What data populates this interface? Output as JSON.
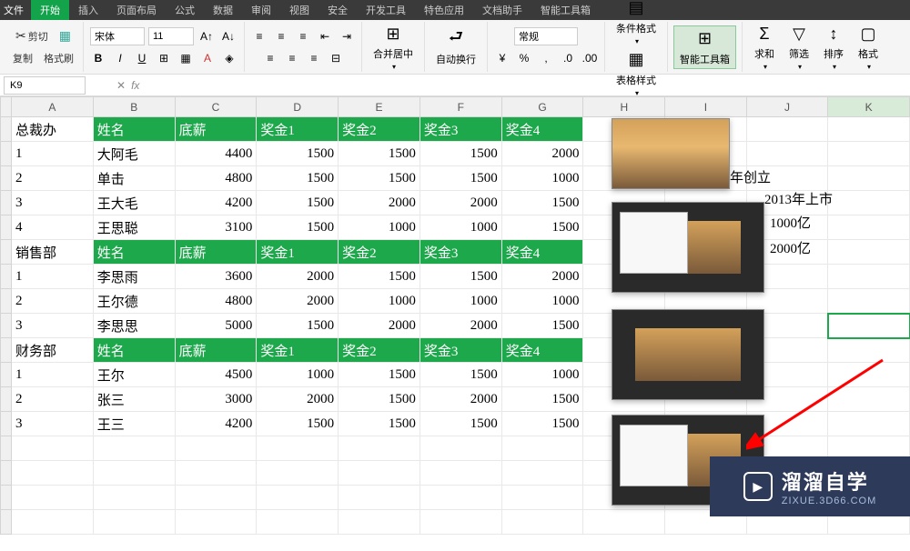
{
  "menu": {
    "file": "文件",
    "tabs": [
      "开始",
      "插入",
      "页面布局",
      "公式",
      "数据",
      "审阅",
      "视图",
      "安全",
      "开发工具",
      "特色应用",
      "文档助手",
      "智能工具箱"
    ],
    "activeTab": 0
  },
  "ribbon": {
    "clipboard": {
      "cut": "剪切",
      "copy": "复制",
      "paint": "格式刷"
    },
    "font": {
      "name": "宋体",
      "size": "11"
    },
    "alignment": {
      "merge": "合并居中",
      "wrap": "自动换行"
    },
    "number": {
      "format": "常规"
    },
    "styles": {
      "cond": "条件格式",
      "table": "表格样式"
    },
    "tools": {
      "smart": "智能工具箱"
    },
    "editing": {
      "sum": "求和",
      "filter": "筛选",
      "sort": "排序",
      "format": "格式"
    }
  },
  "nameBox": "K9",
  "formula": "",
  "columns": [
    "A",
    "B",
    "C",
    "D",
    "E",
    "F",
    "G",
    "H",
    "I",
    "J",
    "K"
  ],
  "rows": [
    {
      "type": "header",
      "cells": [
        "总裁办",
        "姓名",
        "底薪",
        "奖金1",
        "奖金2",
        "奖金3",
        "奖金4"
      ]
    },
    {
      "type": "data",
      "cells": [
        "1",
        "大阿毛",
        "4400",
        "1500",
        "1500",
        "1500",
        "2000"
      ]
    },
    {
      "type": "data",
      "cells": [
        "2",
        "单击",
        "4800",
        "1500",
        "1500",
        "1500",
        "1000"
      ]
    },
    {
      "type": "data",
      "cells": [
        "3",
        "王大毛",
        "4200",
        "1500",
        "2000",
        "2000",
        "1500"
      ]
    },
    {
      "type": "data",
      "cells": [
        "4",
        "王思聪",
        "3100",
        "1500",
        "1000",
        "1000",
        "1500"
      ]
    },
    {
      "type": "header",
      "cells": [
        "销售部",
        "姓名",
        "底薪",
        "奖金1",
        "奖金2",
        "奖金3",
        "奖金4"
      ]
    },
    {
      "type": "data",
      "cells": [
        "1",
        "李思雨",
        "3600",
        "2000",
        "1500",
        "1500",
        "2000"
      ]
    },
    {
      "type": "data",
      "cells": [
        "2",
        "王尔德",
        "4800",
        "2000",
        "1000",
        "1000",
        "1000"
      ]
    },
    {
      "type": "data",
      "cells": [
        "3",
        "李思思",
        "5000",
        "1500",
        "2000",
        "2000",
        "1500"
      ]
    },
    {
      "type": "header",
      "cells": [
        "财务部",
        "姓名",
        "底薪",
        "奖金1",
        "奖金2",
        "奖金3",
        "奖金4"
      ]
    },
    {
      "type": "data",
      "cells": [
        "1",
        "王尔",
        "4500",
        "1000",
        "1500",
        "1500",
        "1000"
      ]
    },
    {
      "type": "data",
      "cells": [
        "2",
        "张三",
        "3000",
        "2000",
        "1500",
        "2000",
        "1500"
      ]
    },
    {
      "type": "data",
      "cells": [
        "3",
        "王三",
        "4200",
        "1500",
        "1500",
        "1500",
        "1500"
      ]
    }
  ],
  "sideText": {
    "line1": "年创立",
    "line2": "2013年上市",
    "line3": "1000亿",
    "line4": "2000亿"
  },
  "selectedCell": {
    "row": 9,
    "col": "K"
  },
  "watermark": {
    "brand": "溜溜自学",
    "url": "ZIXUE.3D66.COM"
  }
}
